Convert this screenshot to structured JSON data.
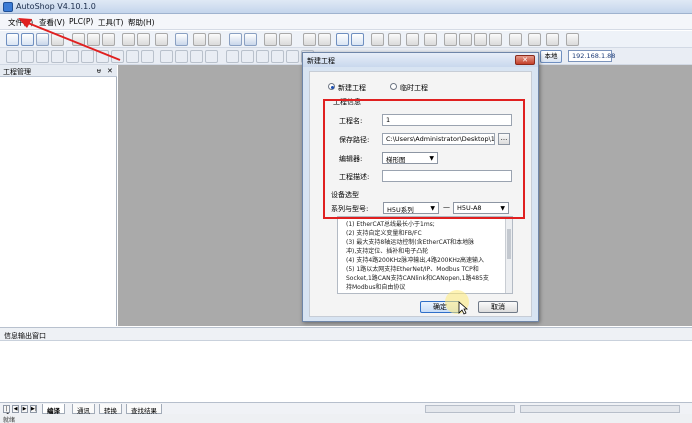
{
  "window": {
    "title": "AutoShop V4.10.1.0"
  },
  "menu": [
    "文件(F)",
    "查看(V)",
    "PLC(P)",
    "工具(T)",
    "帮助(H)"
  ],
  "toolbar": {
    "network_label": "本地",
    "ip": "192.168.1.88"
  },
  "left_panel": {
    "title": "工程管理",
    "pin": "ᵾ",
    "close": "✕"
  },
  "output": {
    "title": "信息输出窗口"
  },
  "tabs": [
    "编译",
    "通讯",
    "转换",
    "查找结果"
  ],
  "tab_nav": [
    "|◀",
    "◀",
    "▶",
    "▶|"
  ],
  "statusbar": {
    "text": "就绪"
  },
  "dialog": {
    "title": "新建工程",
    "close": "✕",
    "radio_new": "新建工程",
    "radio_temp": "临时工程",
    "group_project": "工程信息",
    "name_label": "工程名:",
    "name_value": "1",
    "path_label": "保存路径:",
    "path_value": "C:\\Users\\Administrator\\Desktop\\1\\",
    "browse": "...",
    "editor_label": "编辑器:",
    "editor_value": "梯形图",
    "desc_label": "工程描述:",
    "desc_value": "",
    "group_device": "设备选型",
    "series_label": "系列与型号:",
    "series_value": "H5U系列",
    "model_value": "H5U-A8",
    "dash": "—",
    "description_lines": [
      "(1) EtherCAT总线最长小于1ms;",
      "(2) 支持自定义变量和FB/FC",
      "(3) 最大支持8轴运动控制(含EtherCAT和本地脉",
      "冲),支持定位、插补和电子凸轮",
      "(4) 支持4路200KHz脉冲输出,4路200KHz高速输入",
      "(5) 1路以太网支持EtherNet/IP、Modbus TCP和",
      "Socket,1路CAN支持CANlink和CANopen,1路485支",
      "持Modbus和自由协议"
    ],
    "ok": "确定",
    "cancel": "取消"
  },
  "colors": {
    "annotation": "#e02020",
    "workspace": "#aaaaaa"
  }
}
